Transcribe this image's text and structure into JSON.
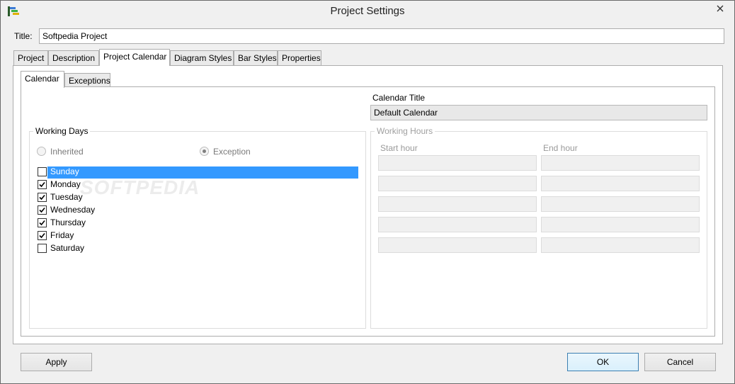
{
  "window": {
    "title": "Project Settings"
  },
  "title_field": {
    "label": "Title:",
    "value": "Softpedia Project"
  },
  "main_tabs": [
    {
      "label": "Project",
      "active": false
    },
    {
      "label": "Description",
      "active": false
    },
    {
      "label": "Project Calendar",
      "active": true
    },
    {
      "label": "Diagram Styles",
      "active": false
    },
    {
      "label": "Bar Styles",
      "active": false
    },
    {
      "label": "Properties",
      "active": false
    }
  ],
  "sub_tabs": [
    {
      "label": "Calendar",
      "active": true
    },
    {
      "label": "Exceptions",
      "active": false
    }
  ],
  "calendar_title": {
    "label": "Calendar Title",
    "value": "Default Calendar"
  },
  "working_days": {
    "legend": "Working Days",
    "radio_inherited": "Inherited",
    "radio_exception": "Exception",
    "selected_radio": "Exception",
    "days": [
      {
        "label": "Sunday",
        "checked": false,
        "selected": true
      },
      {
        "label": "Monday",
        "checked": true,
        "selected": false
      },
      {
        "label": "Tuesday",
        "checked": true,
        "selected": false
      },
      {
        "label": "Wednesday",
        "checked": true,
        "selected": false
      },
      {
        "label": "Thursday",
        "checked": true,
        "selected": false
      },
      {
        "label": "Friday",
        "checked": true,
        "selected": false
      },
      {
        "label": "Saturday",
        "checked": false,
        "selected": false
      }
    ]
  },
  "working_hours": {
    "legend": "Working Hours",
    "start_header": "Start hour",
    "end_header": "End hour",
    "rows": [
      {
        "start": "",
        "end": ""
      },
      {
        "start": "",
        "end": ""
      },
      {
        "start": "",
        "end": ""
      },
      {
        "start": "",
        "end": ""
      },
      {
        "start": "",
        "end": ""
      }
    ]
  },
  "buttons": {
    "apply": "Apply",
    "ok": "OK",
    "cancel": "Cancel"
  },
  "colors": {
    "selection": "#3399ff",
    "check": "#000000"
  },
  "watermark": "SOFTPEDIA"
}
